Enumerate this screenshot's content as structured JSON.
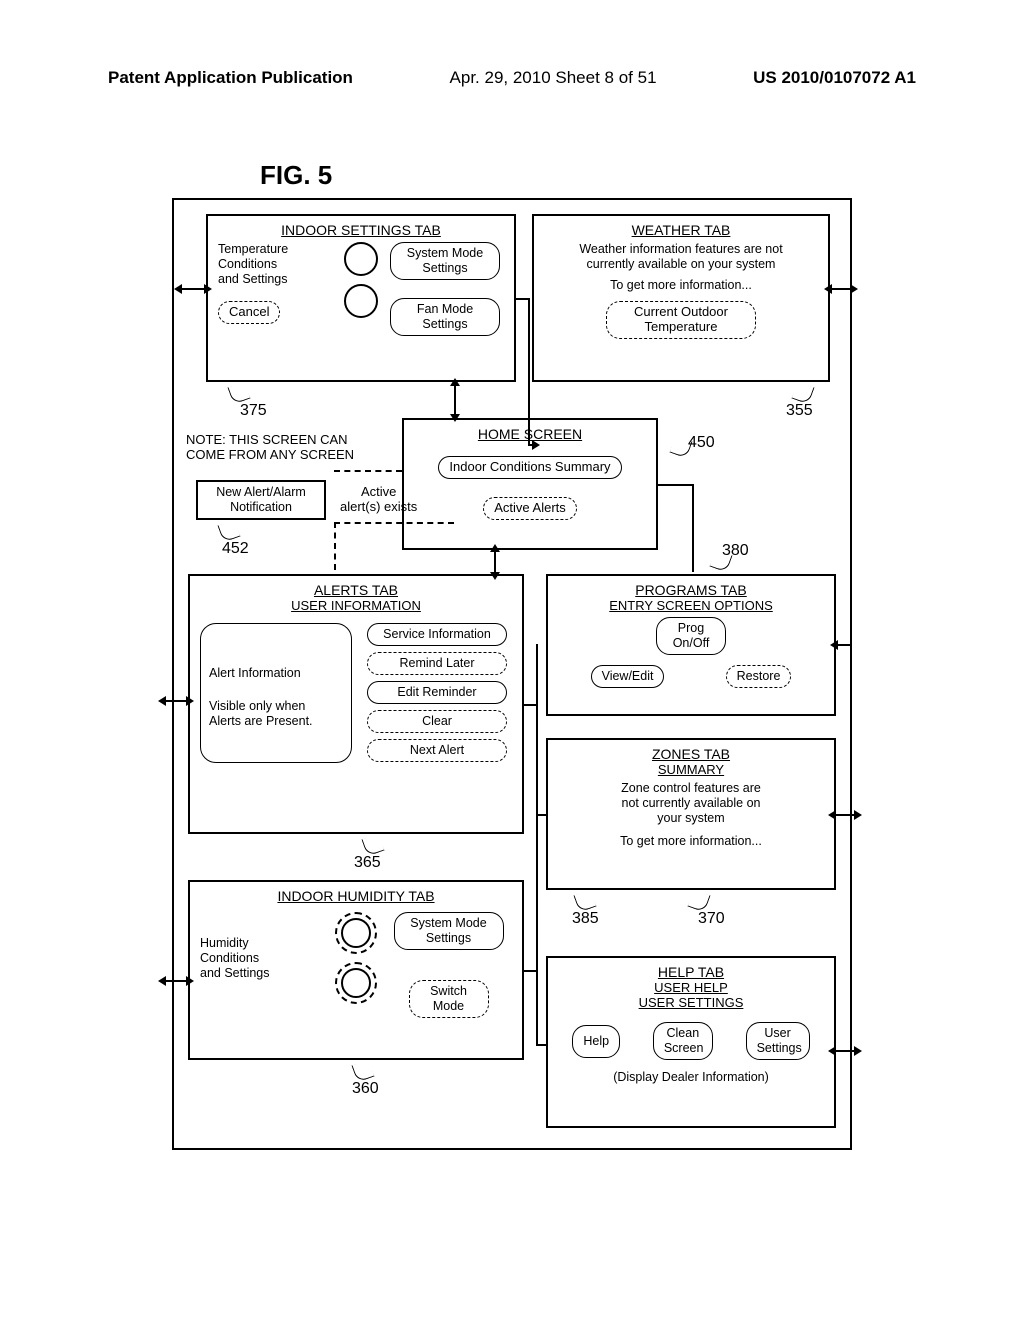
{
  "header": {
    "left": "Patent Application Publication",
    "mid": "Apr. 29, 2010  Sheet 8 of 51",
    "right": "US 2010/0107072 A1"
  },
  "fig": "FIG. 5",
  "indoor": {
    "title": "INDOOR SETTINGS TAB",
    "col1a": "Temperature",
    "col1b": "Conditions",
    "col1c": "and Settings",
    "cancel": "Cancel",
    "sysmode": "System Mode Settings",
    "fanmode": "Fan Mode Settings"
  },
  "weather": {
    "title": "WEATHER TAB",
    "line1": "Weather information features are not",
    "line2": "currently available on your system",
    "line3": "To get more information...",
    "cot": "Current Outdoor Temperature"
  },
  "home": {
    "title": "HOME SCREEN",
    "summary": "Indoor Conditions Summary",
    "active": "Active Alerts"
  },
  "note": {
    "l1": "NOTE:  THIS SCREEN CAN",
    "l2": "COME FROM ANY SCREEN",
    "box1a": "New Alert/Alarm",
    "box1b": "Notification",
    "mid1": "Active",
    "mid2": "alert(s) exists"
  },
  "alerts": {
    "title1": "ALERTS TAB",
    "title2": "USER INFORMATION",
    "box1": "Alert Information",
    "box2a": "Visible only when",
    "box2b": "Alerts are Present.",
    "b_service": "Service Information",
    "b_remind": "Remind Later",
    "b_edit": "Edit Reminder",
    "b_clear": "Clear",
    "b_next": "Next Alert"
  },
  "programs": {
    "title1": "PROGRAMS TAB",
    "title2": "ENTRY SCREEN OPTIONS",
    "prog": "Prog On/Off",
    "view": "View/Edit",
    "restore": "Restore"
  },
  "zones": {
    "title1": "ZONES TAB",
    "title2": "SUMMARY",
    "l1": "Zone control features are",
    "l2": "not currently available on",
    "l3": "your system",
    "l4": "To get more information..."
  },
  "humidity": {
    "title": "INDOOR HUMIDITY TAB",
    "col1a": "Humidity",
    "col1b": "Conditions",
    "col1c": "and Settings",
    "sysmode": "System Mode Settings",
    "switch": "Switch Mode"
  },
  "help": {
    "title1": "HELP TAB",
    "title2": "USER HELP",
    "title3": "USER SETTINGS",
    "b_help": "Help",
    "b_clean": "Clean Screen",
    "b_user": "User Settings",
    "footer": "(Display Dealer Information)"
  },
  "refs": {
    "r375": "375",
    "r355": "355",
    "r450": "450",
    "r452": "452",
    "r380": "380",
    "r365": "365",
    "r385": "385",
    "r370": "370",
    "r360": "360"
  }
}
